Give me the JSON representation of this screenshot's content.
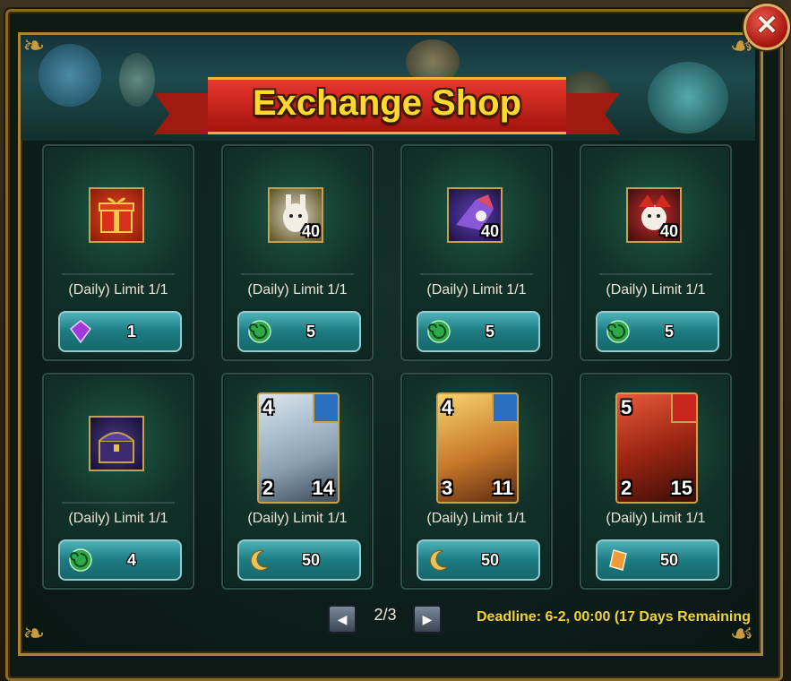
{
  "title": "Exchange Shop",
  "close_icon": "close-x-icon",
  "items": [
    {
      "icon": "gift-box-icon",
      "limit": "(Daily) Limit 1/1",
      "currency_icon": "purple-gem-icon",
      "price": "1",
      "qty": ""
    },
    {
      "icon": "rabbit-jester-shard-icon",
      "limit": "(Daily) Limit 1/1",
      "currency_icon": "green-swirl-orb-icon",
      "price": "5",
      "qty": "40"
    },
    {
      "icon": "purple-fox-shard-icon",
      "limit": "(Daily) Limit 1/1",
      "currency_icon": "green-swirl-orb-icon",
      "price": "5",
      "qty": "40"
    },
    {
      "icon": "red-jester-shard-icon",
      "limit": "(Daily) Limit 1/1",
      "currency_icon": "green-swirl-orb-icon",
      "price": "5",
      "qty": "40"
    },
    {
      "icon": "treasure-chest-icon",
      "limit": "(Daily) Limit 1/1",
      "currency_icon": "green-swirl-orb-icon",
      "price": "4",
      "qty": ""
    },
    {
      "icon": "hero-card-white-icon",
      "limit": "(Daily) Limit 1/1",
      "currency_icon": "gold-crescent-icon",
      "price": "50",
      "cost": "4",
      "left": "2",
      "right": "14"
    },
    {
      "icon": "hero-card-gold-icon",
      "limit": "(Daily) Limit 1/1",
      "currency_icon": "gold-crescent-icon",
      "price": "50",
      "cost": "4",
      "left": "3",
      "right": "11"
    },
    {
      "icon": "hero-card-red-icon",
      "limit": "(Daily) Limit 1/1",
      "currency_icon": "orange-crystal-icon",
      "price": "50",
      "cost": "5",
      "left": "2",
      "right": "15"
    }
  ],
  "pager": {
    "text": "2/3",
    "prev_icon": "arrow-left-icon",
    "next_icon": "arrow-right-icon"
  },
  "deadline": "Deadline: 6-2, 00:00 (17 Days Remaining",
  "colors": {
    "title_gold": "#ffd92e",
    "ribbon_red": "#d42a20",
    "button_teal": "#1d7b82",
    "deadline_yellow": "#f2d23a"
  }
}
